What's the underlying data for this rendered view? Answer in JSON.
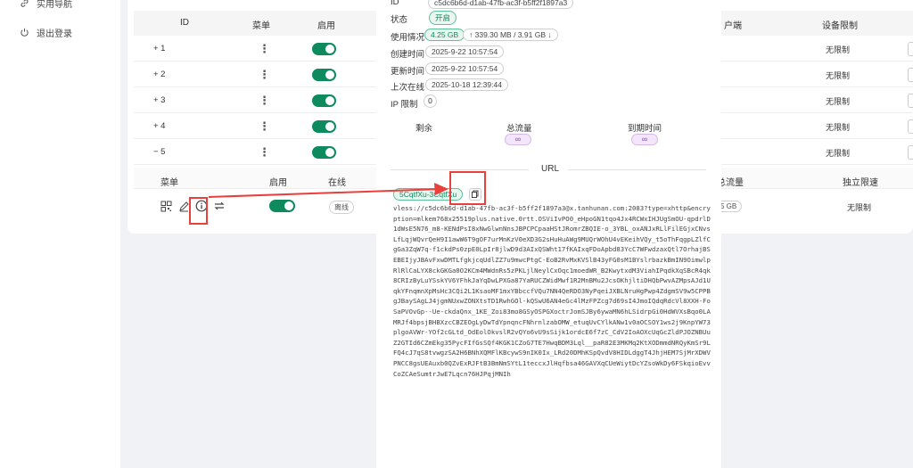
{
  "sidebar": {
    "items": [
      {
        "label": "实用导航",
        "icon": "link-icon"
      },
      {
        "label": "退出登录",
        "icon": "logout-icon"
      }
    ]
  },
  "table": {
    "headers": [
      "ID",
      "菜单",
      "启用",
      "户端",
      "设备限制"
    ],
    "rows": [
      {
        "id": "+ 1",
        "limit": "无限制"
      },
      {
        "id": "+ 2",
        "limit": "无限制"
      },
      {
        "id": "+ 3",
        "limit": "无限制"
      },
      {
        "id": "+ 4",
        "limit": "无限制"
      },
      {
        "id": "− 5",
        "limit": "无限制"
      }
    ],
    "sub_headers": [
      "菜单",
      "启用",
      "在线",
      "总流量",
      "独立限速"
    ],
    "sub_row": {
      "online": "离线",
      "traffic": "5 GB",
      "speed_limit": "无限制"
    }
  },
  "modal": {
    "id_label": "ID",
    "id_value": "c5dc6b6d-d1ab-47fb-ac3f-b5ff2f1897a3",
    "status_label": "状态",
    "status_value": "开启",
    "usage_label": "使用情况",
    "usage_value": "4.25 GB",
    "usage_detail": "↑ 339.30 MB / 3.91 GB ↓",
    "created_label": "创建时间",
    "created_value": "2025-9-22 10:57:54",
    "updated_label": "更新时间",
    "updated_value": "2025-9-22 10:57:54",
    "last_online_label": "上次在线",
    "last_online_value": "2025-10-18 12:39:44",
    "ip_limit_label": "IP 限制",
    "ip_limit_value": "0",
    "stats": [
      {
        "label": "剩余",
        "value": ""
      },
      {
        "label": "总流量",
        "value": "∞"
      },
      {
        "label": "到期时间",
        "value": "∞"
      }
    ],
    "url_title": "URL",
    "url_tag": "5CqtfXu-3CqtfXu",
    "url_text": "vless://c5dc6b6d-d1ab-47fb-ac3f-b5ff2f1897a3@x.tanhunan.com:2083?type=xhttp&encryption=mlkem768x25519plus.native.0rtt.OSViIvPO0_eHpoGN1tqo4Jx4RCWxIHJUgSmOU-qpdrlD1dWsE5N76_m8-KENdPsI8xNwGlwnNnsJBPCPCpaaHStJRomrZBQIE-o_3YBL_oxANJxRLlFilEGjxCNvsLfLqjWQvrQeH9I1awW6T9gOF7urMnKzV0eXD3G2sHuHuAWg9MUQrWOhU4vEKeihVQy_t5oThFqgpLZlfCgGa3ZqW7q-f1ckdPs0zpE0LpIr8jlwD9d3AIxQSWht17fKAIxqFDoApbd83YcC7WFwdzaxQtl7OrhajBSEBEIjyJBAvFxwDMTLfgkjcqUdlZZ7u9mwcPtgC-EoB2RvMxKVSlB43yFG0sM1BYslrbazkBmIN9OimwlpRlRlCaLYX8ckGKGa0O2KCm4MWdnRs5zPKLjlNeylCxOqc1moedWR_B2KwytxdM3ViahIPqdkXqSBcR4qk8CRIzByLuYSskYV6YFhkJaYqDwLPXGa87YaRUCZWidMwf1R2MnBMu2JcsOKhjltiDHQbPwvAZMpsAJd1UqkYFnqmnXpMsHc3CQi2L1KsaoMF1mxYBbccfVQu7NN4QeRDO3NyPqeiJXBLNruHgPwp4ZdgmSV9w5CPPBgJBaySAgLJ4jgmNUxwZONXtsTD1RwhGOl-kQSwU6AN4eGc4lMzFPZcg7d69sI4JmoIQdqRdcVl8XXH-FoSaPVOvGp--Ue-ckdaQnx_1KE_Zoi83mo8GSyOSPGXoctrJomSJBy6ywaMN6hLSidrpGi0HdWVXsBqo0LAMRJf4bpsjBHBXzcCBZEOgLyDwTdYpnqncFNhrnlzabOMW_etuqUvCYlkANw1v0aOCSOY1ws2j9KnpYW73plgoAVWr-YOf2cGLtd_OdEolOkvslR2vQYo6vU9sSijk1ordcE6f7zC_CdV2IoAOXcUqGcZldPJOZNBUuZ2GTId6CZmEkg35PycFIfGsSQf4KGK1CZoG7TE7HwqBDM3Lql__paR82E3MKMq2KtXODmmdNRQyKmSr9LFQ4cJ7qS8tvwgzSA2H6BNhXQMFlKBcywS9nIK0Ix_LRd20DMhKSpQvdV8HIDLdggT4JhjHEM7SjMrXDWVPNCC8gsUEAuxb0QZvExRJFtB3BmNmSYtL1teccxJlHqfbsa46GAVXqCUeWiytDcYZsoWkDy6FSkqioEvvCoZCAeSumtrJwE7Lqcn76HJPqjMNIh"
  }
}
